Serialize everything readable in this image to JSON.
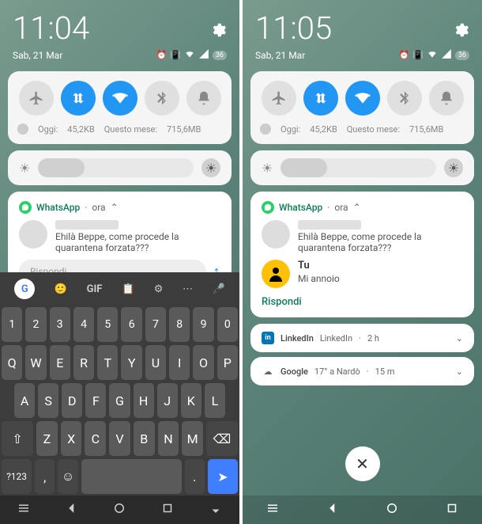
{
  "left": {
    "clock": "11:04",
    "date": "Sab, 21 Mar",
    "battery": "36",
    "qs": {
      "airplane": false,
      "data": true,
      "wifi": true,
      "bt": false,
      "dnd": false
    },
    "data_usage": {
      "today_label": "Oggi:",
      "today_val": "45,2KB",
      "month_label": "Questo mese:",
      "month_val": "715,6MB"
    },
    "whatsapp": {
      "app": "WhatsApp",
      "time": "ora",
      "message": "Ehilà Beppe, come procede la quarantena forzata???",
      "reply_placeholder": "Rispondi"
    },
    "keyboard": {
      "gif": "GIF",
      "row_num": [
        "1",
        "2",
        "3",
        "4",
        "5",
        "6",
        "7",
        "8",
        "9",
        "0"
      ],
      "row_q": [
        "Q",
        "W",
        "E",
        "R",
        "T",
        "Y",
        "U",
        "I",
        "O",
        "P"
      ],
      "row_a": [
        "A",
        "S",
        "D",
        "F",
        "G",
        "H",
        "J",
        "K",
        "L"
      ],
      "row_z": [
        "Z",
        "X",
        "C",
        "V",
        "B",
        "N",
        "M"
      ],
      "sym": "?123",
      "comma": ",",
      "period": "."
    }
  },
  "right": {
    "clock": "11:05",
    "date": "Sab, 21 Mar",
    "battery": "36",
    "qs": {
      "airplane": false,
      "data": true,
      "wifi": true,
      "bt": false,
      "dnd": false
    },
    "data_usage": {
      "today_label": "Oggi:",
      "today_val": "45,2KB",
      "month_label": "Questo mese:",
      "month_val": "715,6MB"
    },
    "whatsapp": {
      "app": "WhatsApp",
      "time": "ora",
      "message": "Ehilà Beppe, come procede la quarantena forzata???",
      "reply_sender": "Tu",
      "reply_text": "Mi annoio",
      "reply_action": "Rispondi"
    },
    "linkedin": {
      "app": "LinkedIn",
      "text": "LinkedIn",
      "time": "2 h"
    },
    "google": {
      "app": "Google",
      "text": "17° a Nardò",
      "time": "15 m"
    }
  }
}
